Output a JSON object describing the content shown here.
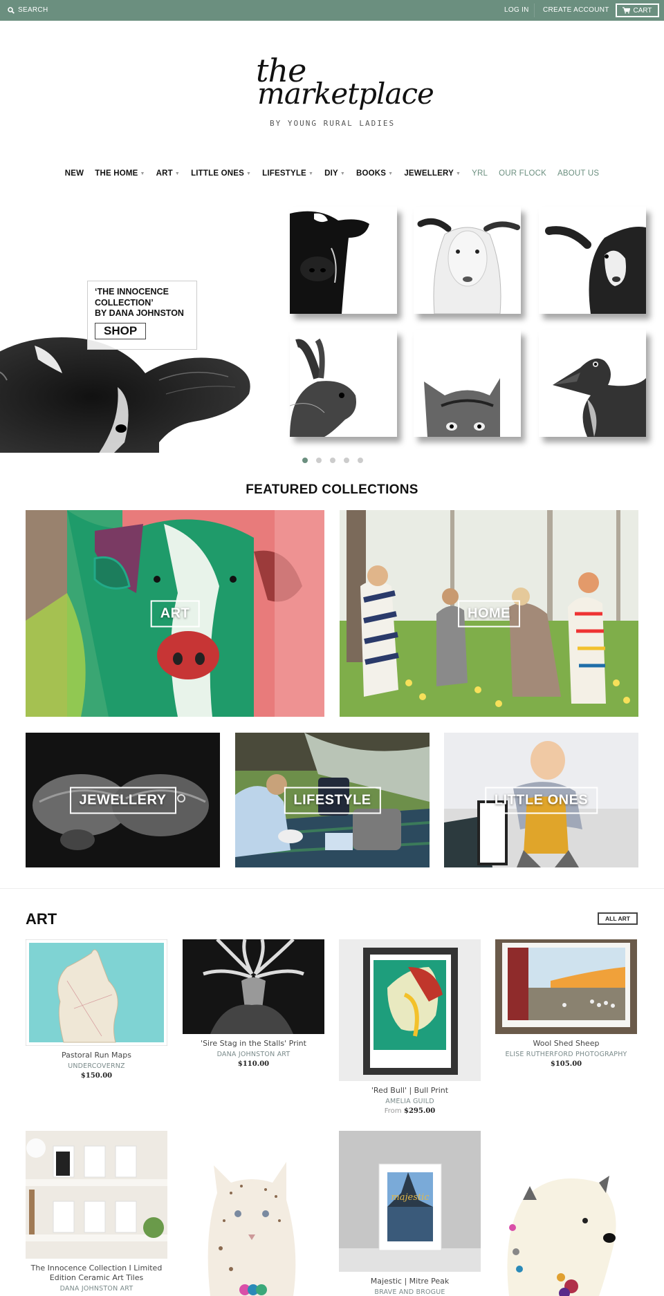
{
  "topbar": {
    "search_label": "SEARCH",
    "login_label": "LOG IN",
    "create_account_label": "CREATE ACCOUNT",
    "cart_label": "CART",
    "bg_color": "#6b8f7f"
  },
  "logo": {
    "line1": "the",
    "line2": "marketplace",
    "tagline": "BY YOUNG RURAL LADIES"
  },
  "nav": {
    "items": [
      {
        "label": "NEW",
        "dropdown": false
      },
      {
        "label": "THE HOME",
        "dropdown": true
      },
      {
        "label": "ART",
        "dropdown": true
      },
      {
        "label": "LITTLE ONES",
        "dropdown": true
      },
      {
        "label": "LIFESTYLE",
        "dropdown": true
      },
      {
        "label": "DIY",
        "dropdown": true
      },
      {
        "label": "BOOKS",
        "dropdown": true
      },
      {
        "label": "JEWELLERY",
        "dropdown": true
      },
      {
        "label": "YRL",
        "dropdown": false
      },
      {
        "label": "OUR FLOCK",
        "dropdown": false
      },
      {
        "label": "ABOUT US",
        "dropdown": false
      }
    ],
    "caret_glyph": "▼"
  },
  "hero": {
    "title_line1": "‘THE INNOCENCE",
    "title_line2": "COLLECTION’",
    "title_line3": "BY DANA JOHNSTON",
    "shop_label": "SHOP",
    "tiles": [
      "calf",
      "lamb",
      "goat",
      "rabbit",
      "kitten",
      "duckling"
    ],
    "slides_total": 5,
    "slide_active": 1
  },
  "featured": {
    "title": "FEATURED COLLECTIONS",
    "collections": [
      {
        "label": "ART"
      },
      {
        "label": "HOME"
      },
      {
        "label": "JEWELLERY"
      },
      {
        "label": "LIFESTYLE"
      },
      {
        "label": "LITTLE ONES"
      }
    ]
  },
  "art_section": {
    "title": "ART",
    "all_label": "ALL ART",
    "products": [
      {
        "name": "Pastoral Run Maps",
        "vendor": "UNDERCOVERNZ",
        "price": "$150.00",
        "from": ""
      },
      {
        "name": "'Sire Stag in the Stalls' Print",
        "vendor": "DANA JOHNSTON ART",
        "price": "$110.00",
        "from": ""
      },
      {
        "name": "'Red Bull' | Bull Print",
        "vendor": "AMELIA GUILD",
        "price": "$295.00",
        "from": "From"
      },
      {
        "name": "Wool Shed Sheep",
        "vendor": "ELISE RUTHERFORD PHOTOGRAPHY",
        "price": "$105.00",
        "from": ""
      },
      {
        "name": "The Innocence Collection I Limited Edition Ceramic Art Tiles",
        "vendor": "DANA JOHNSTON ART"
      },
      {
        "name": "",
        "vendor": ""
      },
      {
        "name": "Majestic | Mitre Peak",
        "vendor": "BRAVE AND BROGUE"
      },
      {
        "name": "",
        "vendor": ""
      }
    ]
  }
}
